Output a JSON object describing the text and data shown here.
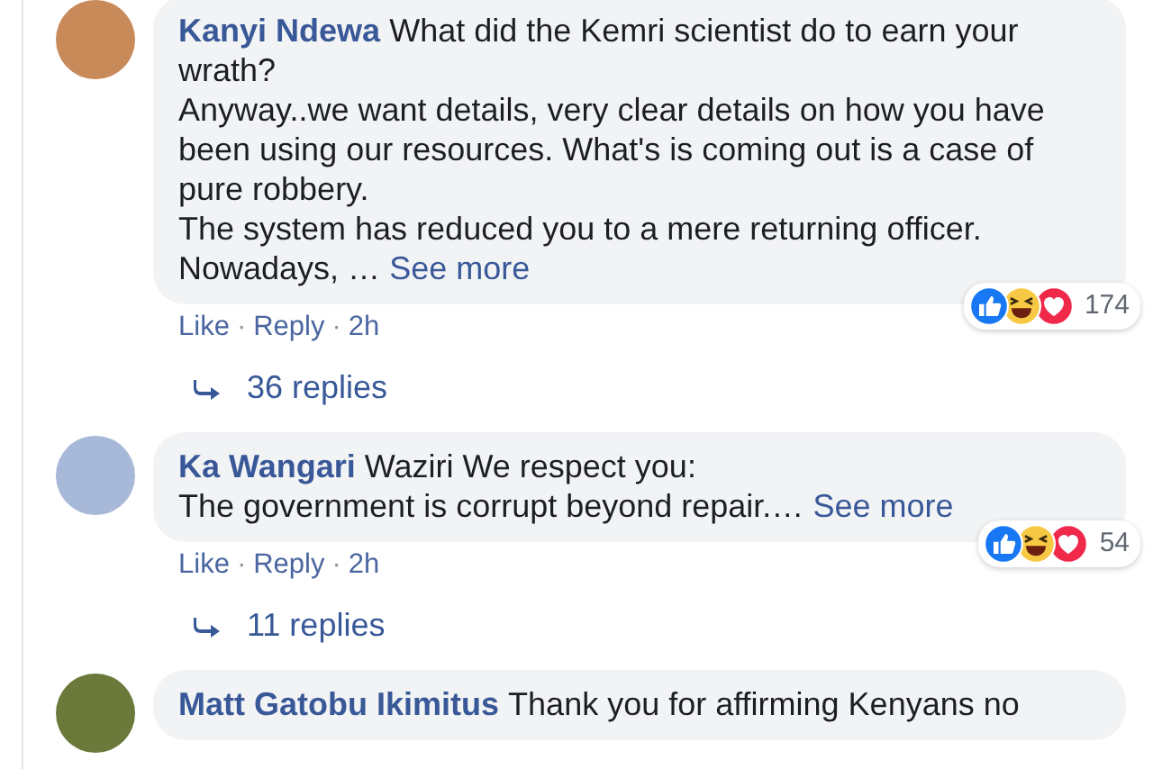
{
  "comments": [
    {
      "name": "Kanyi Ndewa",
      "text": "What did the Kemri scientist do to earn your wrath?\nAnyway..we want details, very clear details on how you have been using our resources. What's is coming out is a case of pure robbery.\nThe system has reduced you to a mere returning officer.\nNowadays, …",
      "see_more": "See more",
      "actions": [
        "Like",
        "Reply",
        "2h"
      ],
      "separator": "·",
      "reactions": [
        {
          "kind": "like"
        },
        {
          "kind": "haha"
        },
        {
          "kind": "love"
        }
      ],
      "reaction_count": "174",
      "replies": "36 replies"
    },
    {
      "name": "Ka Wangari",
      "text": "Waziri We respect you:\nThe government is corrupt beyond repair.…",
      "see_more": "See more",
      "actions": [
        "Like",
        "Reply",
        "2h"
      ],
      "separator": "·",
      "reactions": [
        {
          "kind": "like"
        },
        {
          "kind": "haha"
        },
        {
          "kind": "love"
        }
      ],
      "reaction_count": "54",
      "replies": "11 replies"
    },
    {
      "name": "Matt Gatobu Ikimitus",
      "text": "Thank you for affirming Kenyans no"
    }
  ]
}
